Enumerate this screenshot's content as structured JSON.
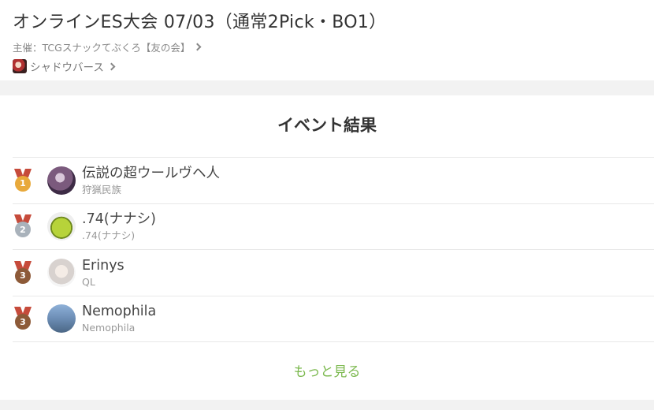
{
  "header": {
    "title": "オンラインES大会 07/03（通常2Pick・BO1）",
    "organizer": "主催：TCGスナックてぶくろ【友の会】",
    "game": "シャドウバース"
  },
  "results": {
    "title": "イベント結果",
    "more_label": "もっと見る",
    "entries": [
      {
        "rank": "1",
        "medal_color": "#e8a93b",
        "player": "伝説の超ウールヴヘ人",
        "deck": "狩猟民族"
      },
      {
        "rank": "2",
        "medal_color": "#a9b2bb",
        "player": ".74(ナナシ)",
        "deck": ".74(ナナシ)"
      },
      {
        "rank": "3",
        "medal_color": "#8d5a38",
        "player": "Erinys",
        "deck": "QL"
      },
      {
        "rank": "3",
        "medal_color": "#8d5a38",
        "player": "Nemophila",
        "deck": "Nemophila"
      }
    ]
  }
}
